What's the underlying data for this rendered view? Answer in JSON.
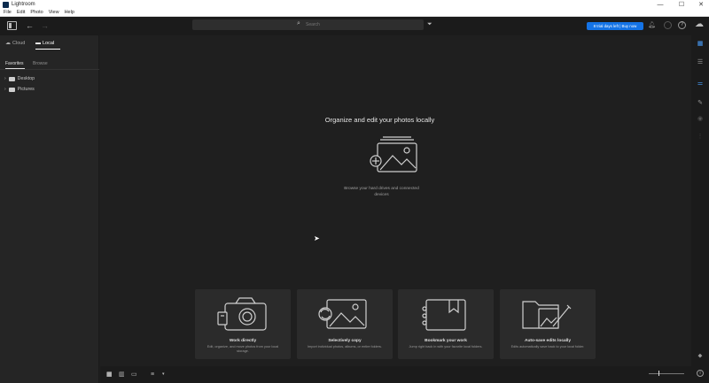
{
  "window": {
    "title": "Lightroom",
    "minimize": "—",
    "maximize": "☐",
    "close": "✕"
  },
  "menu": [
    "File",
    "Edit",
    "Photo",
    "View",
    "Help"
  ],
  "toolbar": {
    "search_placeholder": "Search",
    "trial_label": "8 trial days left | Buy now"
  },
  "sidebar": {
    "segments": {
      "cloud": "Cloud",
      "local": "Local"
    },
    "subtabs": {
      "favorites": "Favorites",
      "browse": "Browse"
    },
    "tree": [
      {
        "label": "Desktop"
      },
      {
        "label": "Pictures"
      }
    ]
  },
  "main": {
    "heading": "Organize and edit your photos locally",
    "subtext": "Browse your hard drives and connected devices",
    "cards": [
      {
        "title": "Work directly",
        "desc": "Edit, organize, and move photos from your local storage."
      },
      {
        "title": "Selectively copy",
        "desc": "Import individual photos, albums, or entire folders."
      },
      {
        "title": "Bookmark your work",
        "desc": "Jump right back in with your favorite local folders."
      },
      {
        "title": "Auto-save edits locally",
        "desc": "Edits automatically save back to your local folder."
      }
    ]
  },
  "icons": {
    "panel": "sidebar-toggle-icon",
    "back": "back-arrow-icon",
    "forward": "forward-arrow-icon",
    "search": "search-icon",
    "filter": "filter-icon",
    "bell": "bell-icon",
    "help": "help-icon",
    "cloud": "cloud-icon"
  },
  "colors": {
    "accent": "#1473e6",
    "background": "#1f1f1f",
    "card": "#2b2b2b"
  }
}
